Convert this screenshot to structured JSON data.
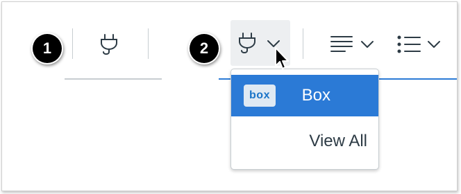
{
  "annotations": {
    "step1": "1",
    "step2": "2"
  },
  "toolbar": {
    "tools_button_1": {
      "icon": "plug-icon"
    },
    "tools_button_2": {
      "icon": "plug-icon",
      "dropdown_icon": "chevron-down-icon"
    },
    "align_button": {
      "icon": "align-left-icon",
      "dropdown_icon": "chevron-down-icon"
    },
    "list_button": {
      "icon": "bulleted-list-icon",
      "dropdown_icon": "chevron-down-icon"
    }
  },
  "menu": {
    "items": [
      {
        "label": "Box",
        "icon": "box-logo",
        "logo_text": "box",
        "selected": true
      },
      {
        "label": "View All",
        "selected": false
      }
    ]
  },
  "colors": {
    "accent": "#2b7ad6",
    "text": "#2d3b45",
    "icon": "#2d3b45",
    "divider": "#c7cdd1",
    "badge": "#000000"
  }
}
